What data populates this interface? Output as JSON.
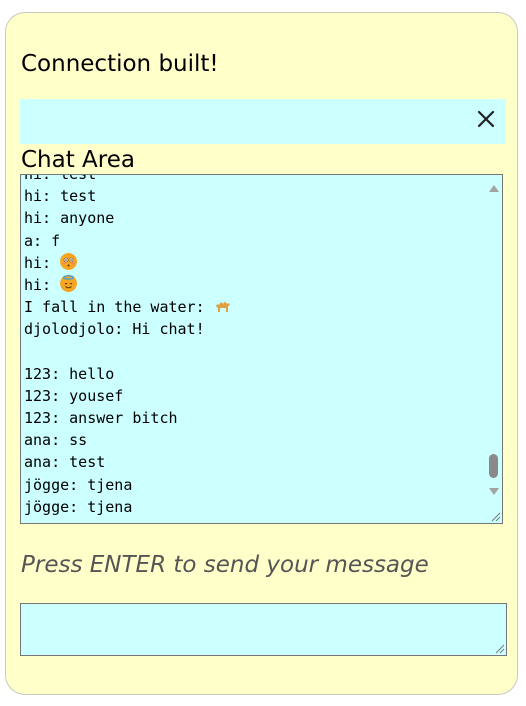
{
  "status_text": "Connection built!",
  "chat_label": "Chat Area",
  "chat_lines": [
    {
      "text": "hi: test"
    },
    {
      "text": "hi: test"
    },
    {
      "text": "hi: anyone"
    },
    {
      "text": "a: f"
    },
    {
      "text": "hi: ",
      "emoji": "flushed-face-emoji",
      "emoji_color": "#f5a623"
    },
    {
      "text": "hi: ",
      "emoji": "smiling-face-with-halo-emoji",
      "emoji_color": "#f5a623"
    },
    {
      "text": "I fall in the water: ",
      "emoji": "camel-emoji",
      "emoji_color": "#e0a040"
    },
    {
      "text": "djolodjolo: Hi chat!"
    },
    {
      "text": ""
    },
    {
      "text": "123: hello"
    },
    {
      "text": "123: yousef"
    },
    {
      "text": "123: answer bitch"
    },
    {
      "text": "ana: ss"
    },
    {
      "text": "ana: test"
    },
    {
      "text": "jögge: tjena"
    },
    {
      "text": "jögge: tjena"
    }
  ],
  "prompt_text": "Press ENTER to send your message",
  "message_input": {
    "value": ""
  },
  "colors": {
    "card_bg": "#ffffca",
    "field_bg": "#ccffff"
  },
  "icons": {
    "close": "close-icon",
    "resize": "resize-grip-icon"
  }
}
